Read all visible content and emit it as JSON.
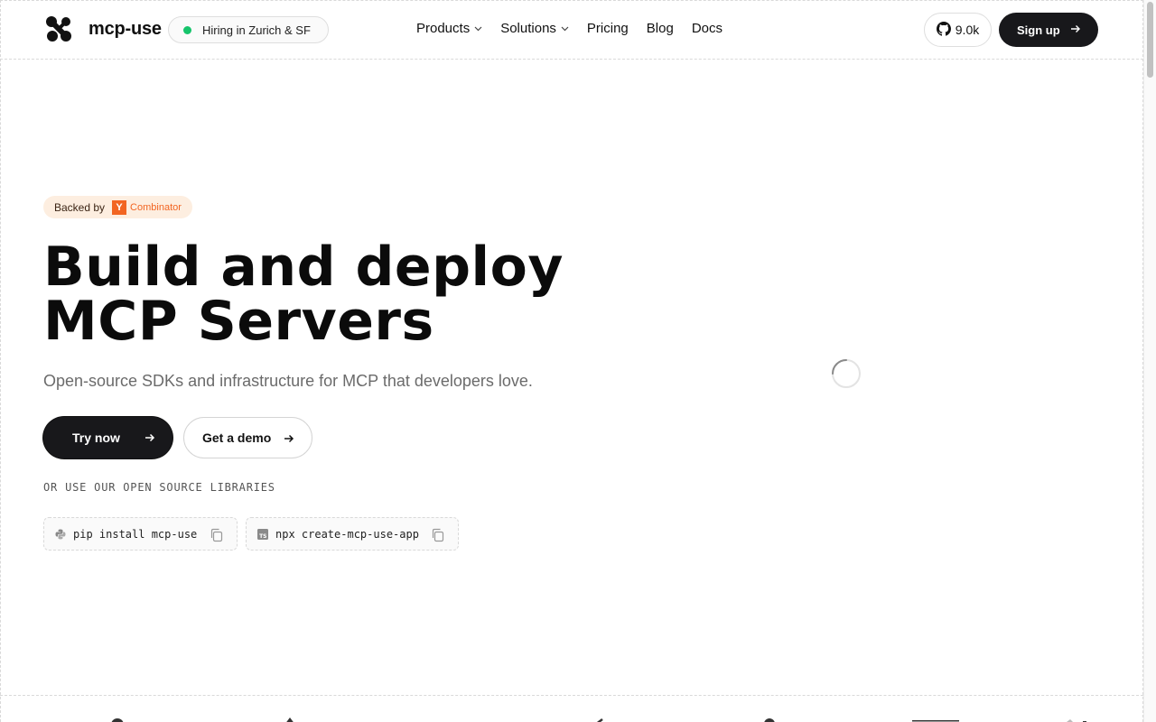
{
  "header": {
    "brand": "mcp-use",
    "hiring_label": "Hiring in Zurich & SF",
    "nav": [
      {
        "label": "Products",
        "dropdown": true
      },
      {
        "label": "Solutions",
        "dropdown": true
      },
      {
        "label": "Pricing",
        "dropdown": false
      },
      {
        "label": "Blog",
        "dropdown": false
      },
      {
        "label": "Docs",
        "dropdown": false
      }
    ],
    "github_stars": "9.0k",
    "signup_label": "Sign up"
  },
  "hero": {
    "badge_prefix": "Backed by",
    "badge_yc_letter": "Y",
    "badge_yc_name": "Combinator",
    "title_line1": "Build and deploy",
    "title_line2": "MCP Servers",
    "subtitle": "Open-source SDKs and infrastructure for MCP that developers love.",
    "primary_cta": "Try now",
    "secondary_cta": "Get a demo",
    "libraries_label": "OR USE OUR OPEN SOURCE LIBRARIES",
    "install_commands": [
      {
        "lang": "python",
        "command": "pip install mcp-use"
      },
      {
        "lang": "typescript",
        "command": "npx create-mcp-use-app"
      }
    ]
  },
  "colors": {
    "primary": "#18181b",
    "hiring_dot": "#16c46b",
    "yc_orange": "#f26522",
    "badge_bg": "#fdeee0"
  },
  "icons": [
    "mcp-use-logo-icon",
    "github-icon",
    "arrow-right-icon",
    "chevron-down-icon",
    "python-icon",
    "typescript-icon",
    "copy-icon",
    "loading-spinner-icon"
  ]
}
